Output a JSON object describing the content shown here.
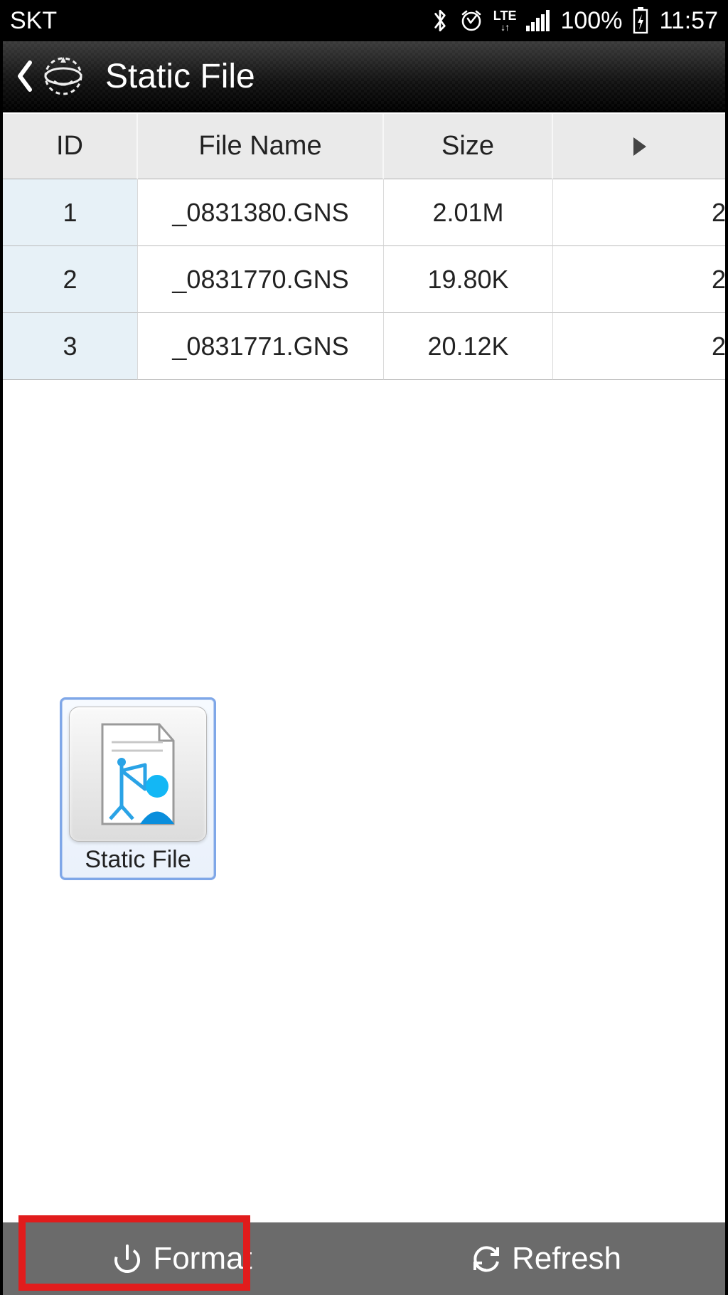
{
  "status": {
    "carrier": "SKT",
    "network": "LTE",
    "battery": "100%",
    "time": "11:57"
  },
  "header": {
    "title": "Static File"
  },
  "table": {
    "columns": {
      "id": "ID",
      "name": "File Name",
      "size": "Size"
    },
    "rows": [
      {
        "id": "1",
        "name": "_0831380.GNS",
        "size": "2.01M"
      },
      {
        "id": "2",
        "name": "_0831770.GNS",
        "size": "19.80K"
      },
      {
        "id": "3",
        "name": "_0831771.GNS",
        "size": "20.12K"
      }
    ]
  },
  "tile": {
    "label": "Static File"
  },
  "footer": {
    "format": "Format",
    "refresh": "Refresh"
  }
}
